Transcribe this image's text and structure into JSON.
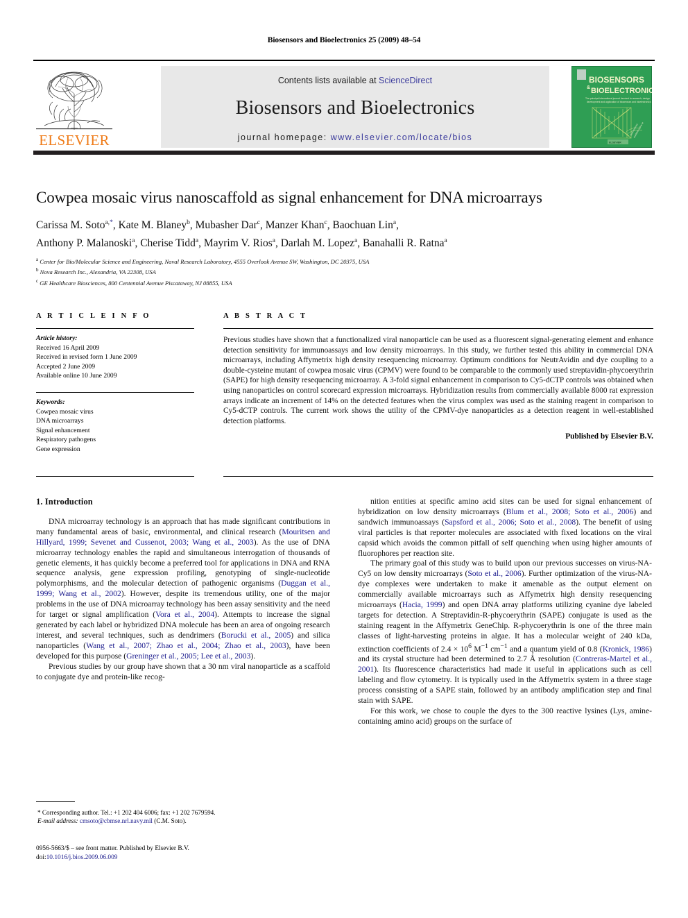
{
  "running_head": "Biosensors and Bioelectronics 25 (2009) 48–54",
  "masthead": {
    "contents_prefix": "Contents lists available at ",
    "sciencedirect": "ScienceDirect",
    "journal_name": "Biosensors and Bioelectronics",
    "homepage_prefix": "journal homepage: ",
    "homepage_url": "www.elsevier.com/locate/bios",
    "publisher_wordmark": "ELSEVIER",
    "cover_title_1": "BIOSENSORS",
    "cover_amp": "&",
    "cover_title_2": "BIOELECTRONICS",
    "cover_sub": "The principal international journal devoted to research, design, development and application of biosensors and bioelectronics",
    "cover_logo_text": "ELSEVIER",
    "colors": {
      "link_blue": "#3a3a9c",
      "elsevier_orange": "#ef7c1a",
      "cover_green": "#2f9e54",
      "masthead_grey": "#e8e8e8"
    }
  },
  "article": {
    "title": "Cowpea mosaic virus nanoscaffold as signal enhancement for DNA microarrays",
    "authors_line_1": "Carissa M. Soto<sup>a,</sup><sup class=\"star\">*</sup>, Kate M. Blaney<sup>b</sup>, Mubasher Dar<sup>c</sup>, Manzer Khan<sup>c</sup>, Baochuan Lin<sup>a</sup>,",
    "authors_line_2": "Anthony P. Malanoski<sup>a</sup>, Cherise Tidd<sup>a</sup>, Mayrim V. Rios<sup>a</sup>, Darlah M. Lopez<sup>a</sup>, Banahalli R. Ratna<sup>a</sup>",
    "affiliations": [
      "<sup>a</sup> Center for Bio/Molecular Science and Engineering, Naval Research Laboratory, 4555 Overlook Avenue SW, Washington, DC 20375, USA",
      "<sup>b</sup> Nova Research Inc., Alexandria, VA 22308, USA",
      "<sup>c</sup> GE Healthcare Biosciences, 800 Centennial Avenue Piscataway, NJ 08855, USA"
    ]
  },
  "article_info": {
    "heading": "A R T I C L E    I N F O",
    "history_label": "Article history:",
    "history": [
      "Received 16 April 2009",
      "Received in revised form 1 June 2009",
      "Accepted 2 June 2009",
      "Available online 10 June 2009"
    ],
    "keywords_label": "Keywords:",
    "keywords": [
      "Cowpea mosaic virus",
      "DNA microarrays",
      "Signal enhancement",
      "Respiratory pathogens",
      "Gene expression"
    ]
  },
  "abstract": {
    "heading": "A B S T R A C T",
    "text": "Previous studies have shown that a functionalized viral nanoparticle can be used as a fluorescent signal-generating element and enhance detection sensitivity for immunoassays and low density microarrays. In this study, we further tested this ability in commercial DNA microarrays, including Affymetrix high density resequencing microarray. Optimum conditions for NeutrAvidin and dye coupling to a double-cysteine mutant of cowpea mosaic virus (CPMV) were found to be comparable to the commonly used streptavidin-phycoerythrin (SAPE) for high density resequencing microarray. A 3-fold signal enhancement in comparison to Cy5-dCTP controls was obtained when using nanoparticles on control scorecard expression microarrays. Hybridization results from commercially available 8000 rat expression arrays indicate an increment of 14% on the detected features when the virus complex was used as the staining reagent in comparison to Cy5-dCTP controls. The current work shows the utility of the CPMV-dye nanoparticles as a detection reagent in well-established detection platforms.",
    "publisher_note": "Published by Elsevier B.V."
  },
  "body": {
    "section_1_heading": "1.  Introduction",
    "left_paragraphs": [
      "DNA microarray technology is an approach that has made significant contributions in many fundamental areas of basic, environmental, and clinical research (<span class=\"ref\">Mouritsen and Hillyard, 1999; Sevenet and Cussenot, 2003; Wang et al., 2003</span>). As the use of DNA microarray technology enables the rapid and simultaneous interrogation of thousands of genetic elements, it has quickly become a preferred tool for applications in DNA and RNA sequence analysis, gene expression profiling, genotyping of single-nucleotide polymorphisms, and the molecular detection of pathogenic organisms (<span class=\"ref\">Duggan et al., 1999; Wang et al., 2002</span>). However, despite its tremendous utility, one of the major problems in the use of DNA microarray technology has been assay sensitivity and the need for target or signal amplification (<span class=\"ref\">Vora et al., 2004</span>). Attempts to increase the signal generated by each label or hybridized DNA molecule has been an area of ongoing research interest, and several techniques, such as dendrimers (<span class=\"ref\">Borucki et al., 2005</span>) and silica nanoparticles (<span class=\"ref\">Wang et al., 2007; Zhao et al., 2004; Zhao et al., 2003</span>), have been developed for this purpose (<span class=\"ref\">Greninger et al., 2005; Lee et al., 2003</span>).",
      "Previous studies by our group have shown that a 30 nm viral nanoparticle as a scaffold to conjugate dye and protein-like recog-"
    ],
    "right_paragraphs": [
      "nition entities at specific amino acid sites can be used for signal enhancement of hybridization on low density microarrays (<span class=\"ref\">Blum et al., 2008; Soto et al., 2006</span>) and sandwich immunoassays (<span class=\"ref\">Sapsford et al., 2006; Soto et al., 2008</span>). The benefit of using viral particles is that reporter molecules are associated with fixed locations on the viral capsid which avoids the common pitfall of self quenching when using higher amounts of fluorophores per reaction site.",
      "The primary goal of this study was to build upon our previous successes on virus-NA-Cy5 on low density microarrays (<span class=\"ref\">Soto et al., 2006</span>). Further optimization of the virus-NA-dye complexes were undertaken to make it amenable as the output element on commercially available microarrays such as Affymetrix high density resequencing microarrays (<span class=\"ref\">Hacia, 1999</span>) and open DNA array platforms utilizing cyanine dye labeled targets for detection. A Streptavidin-R-phycoerythrin (SAPE) conjugate is used as the staining reagent in the Affymetrix GeneChip. R-phycoerythrin is one of the three main classes of light-harvesting proteins in algae. It has a molecular weight of 240 kDa, extinction coefficients of 2.4 × 10<sup>6</sup> M<sup>−1</sup> cm<sup>−1</sup> and a quantum yield of 0.8 (<span class=\"ref\">Kronick, 1986</span>) and its crystal structure had been determined to 2.7 Å resolution (<span class=\"ref\">Contreras-Martel et al., 2001</span>). Its fluorescence characteristics had made it useful in applications such as cell labeling and flow cytometry. It is typically used in the Affymetrix system in a three stage process consisting of a SAPE stain, followed by an antibody amplification step and final stain with SAPE.",
      "For this work, we chose to couple the dyes to the 300 reactive lysines (Lys, amine-containing amino acid) groups on the surface of"
    ]
  },
  "footnotes": {
    "corresponding": "*  Corresponding author. Tel.: +1 202 404 6006; fax: +1 202 7679594.",
    "email_label": "E-mail address:",
    "email": "cmsoto@cbmse.nrl.navy.mil",
    "email_suffix": " (C.M. Soto).",
    "issn_line": "0956-5663/$ – see front matter. Published by Elsevier B.V.",
    "doi_label": "doi:",
    "doi": "10.1016/j.bios.2009.06.009"
  }
}
